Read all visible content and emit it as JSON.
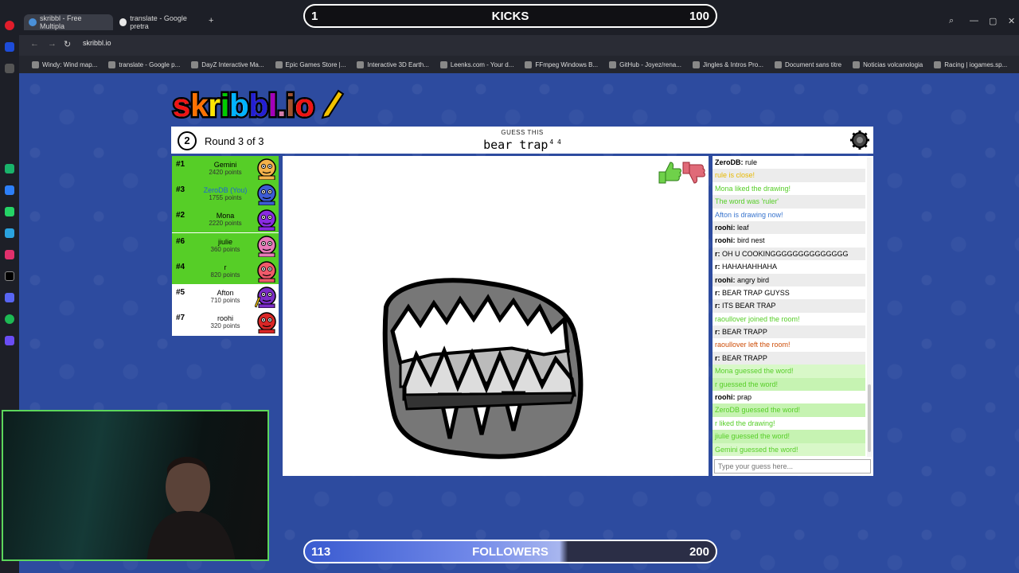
{
  "browser": {
    "tabs": [
      {
        "label": "skribbl - Free Multipla"
      },
      {
        "label": "translate - Google pretra"
      }
    ],
    "address": "skribbl.io",
    "bookmarks": [
      "Windy: Wind map...",
      "translate - Google p...",
      "DayZ Interactive Ma...",
      "Epic Games Store |...",
      "Interactive 3D Earth...",
      "Leenks.com - Your d...",
      "FFmpeg Windows B...",
      "GitHub - Joyez/rena...",
      "Jingles & Intros Pro...",
      "Document sans titre",
      "Noticias volcanologia",
      "Racing | iogames.sp..."
    ]
  },
  "overlay": {
    "kicks": {
      "left": "1",
      "label": "KICKS",
      "right": "100",
      "progress": 0.01
    },
    "followers": {
      "left": "113",
      "label": "FOLLOWERS",
      "right": "200",
      "progress": 0.565
    }
  },
  "game": {
    "logo": "skribbl.io",
    "clock": "2",
    "round": "Round 3 of 3",
    "guess_label": "GUESS THIS",
    "word": "bear trap",
    "word_hint": "4 4",
    "players": [
      {
        "rank": "#1",
        "name": "Gemini",
        "points": "2420 points",
        "color": "#f3b24a",
        "green": true
      },
      {
        "rank": "#3",
        "name": "ZeroDB (You)",
        "points": "1755 points",
        "color": "#3d5bd4",
        "green": true,
        "you": true
      },
      {
        "rank": "#2",
        "name": "Mona",
        "points": "2220 points",
        "color": "#8a2be2",
        "green": true
      },
      {
        "rank": "#6",
        "name": "jiulie",
        "points": "360 points",
        "color": "#e87ab9",
        "green": true
      },
      {
        "rank": "#4",
        "name": "r",
        "points": "820 points",
        "color": "#ef5a6a",
        "green": true
      },
      {
        "rank": "#5",
        "name": "Afton",
        "points": "710 points",
        "color": "#7b2cc7",
        "green": false,
        "drawing": true
      },
      {
        "rank": "#7",
        "name": "roohi",
        "points": "320 points",
        "color": "#d92727",
        "green": false
      }
    ],
    "chat": [
      {
        "user": "ZeroDB:",
        "text": " rule",
        "color": "#000"
      },
      {
        "user": "",
        "text": "rule is close!",
        "color": "#e6b800"
      },
      {
        "user": "",
        "text": "Mona liked the drawing!",
        "color": "#56ce27"
      },
      {
        "user": "",
        "text": "The word was 'ruler'",
        "color": "#56ce27"
      },
      {
        "user": "",
        "text": "Afton is drawing now!",
        "color": "#3975ce"
      },
      {
        "user": "roohi:",
        "text": " leaf",
        "color": "#000"
      },
      {
        "user": "roohi:",
        "text": " bird nest",
        "color": "#000"
      },
      {
        "user": "r:",
        "text": " OH U COOKINGGGGGGGGGGGGGG",
        "color": "#000"
      },
      {
        "user": "r:",
        "text": " HAHAHAHHAHA",
        "color": "#000"
      },
      {
        "user": "roohi:",
        "text": " angry bird",
        "color": "#000"
      },
      {
        "user": "r:",
        "text": " BEAR TRAP GUYSS",
        "color": "#000"
      },
      {
        "user": "r:",
        "text": " ITS BEAR TRAP",
        "color": "#000"
      },
      {
        "user": "",
        "text": "raoullover joined the room!",
        "color": "#56ce27"
      },
      {
        "user": "r:",
        "text": " BEAR TRAPP",
        "color": "#000"
      },
      {
        "user": "",
        "text": "raoullover left the room!",
        "color": "#ce4f0a"
      },
      {
        "user": "r:",
        "text": " BEAR TRAPP",
        "color": "#000"
      },
      {
        "user": "",
        "text": "Mona guessed the word!",
        "color": "#56ce27",
        "guess": true
      },
      {
        "user": "",
        "text": "r guessed the word!",
        "color": "#56ce27",
        "guess": true
      },
      {
        "user": "roohi:",
        "text": " prap",
        "color": "#000"
      },
      {
        "user": "",
        "text": "ZeroDB guessed the word!",
        "color": "#56ce27",
        "guess": true
      },
      {
        "user": "",
        "text": "r liked the drawing!",
        "color": "#56ce27"
      },
      {
        "user": "",
        "text": "jiulie guessed the word!",
        "color": "#56ce27",
        "guess": true
      },
      {
        "user": "",
        "text": "Gemini guessed the word!",
        "color": "#56ce27",
        "guess": true
      }
    ],
    "input_placeholder": "Type your guess here..."
  }
}
